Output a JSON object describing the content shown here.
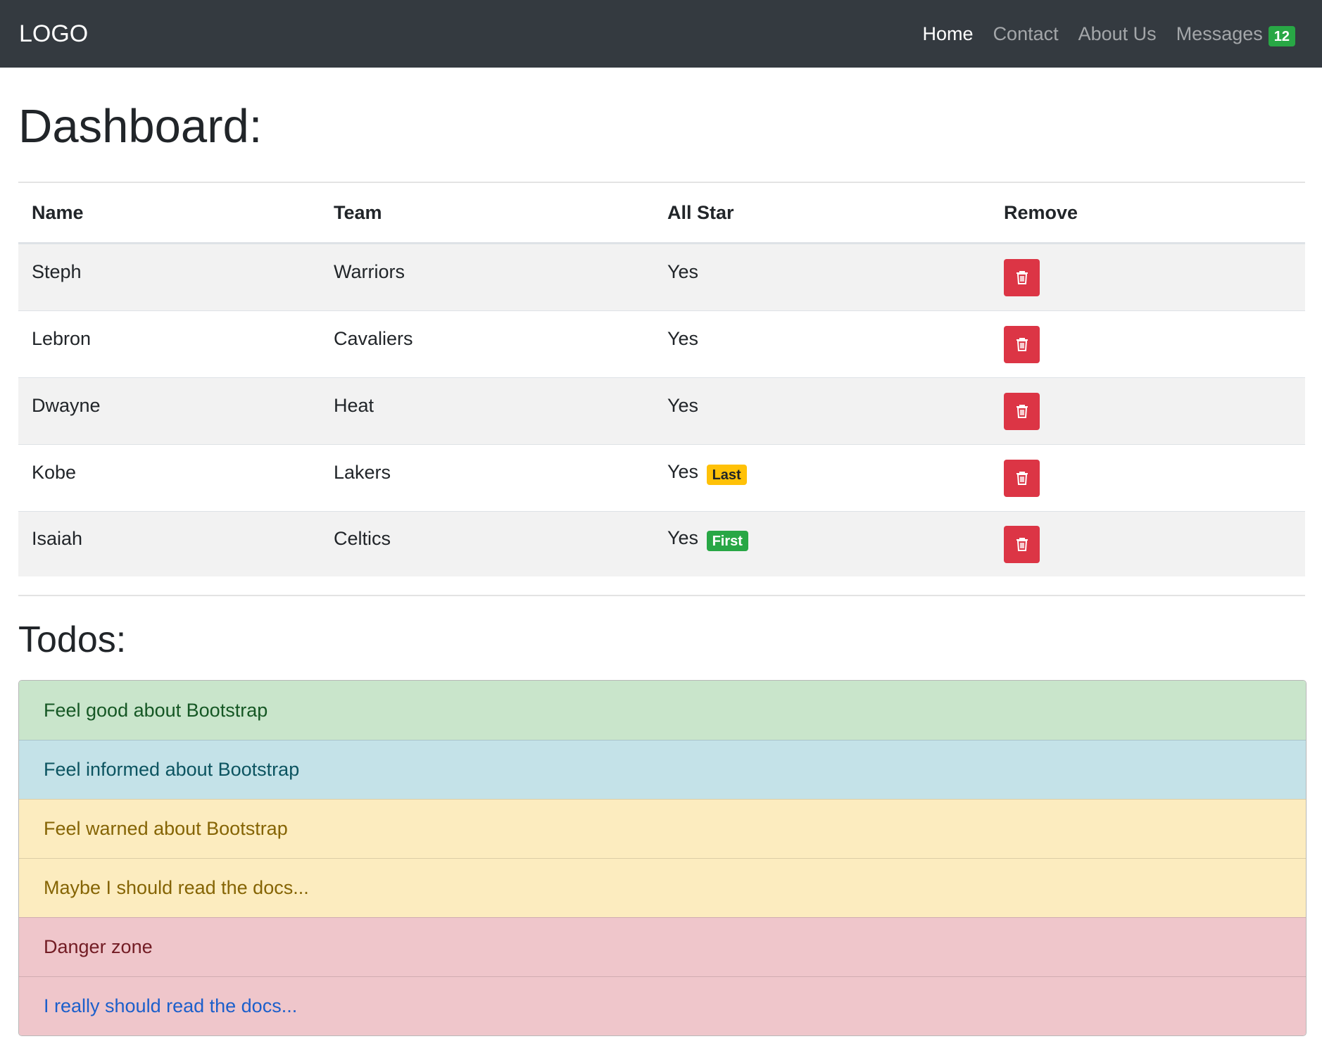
{
  "navbar": {
    "brand": "LOGO",
    "links": [
      {
        "label": "Home",
        "active": true
      },
      {
        "label": "Contact",
        "active": false
      },
      {
        "label": "About Us",
        "active": false
      },
      {
        "label": "Messages",
        "active": false,
        "badge": "12"
      }
    ]
  },
  "dashboard": {
    "title": "Dashboard:",
    "columns": [
      "Name",
      "Team",
      "All Star",
      "Remove"
    ],
    "rows": [
      {
        "name": "Steph",
        "team": "Warriors",
        "all_star": "Yes",
        "tag": ""
      },
      {
        "name": "Lebron",
        "team": "Cavaliers",
        "all_star": "Yes",
        "tag": ""
      },
      {
        "name": "Dwayne",
        "team": "Heat",
        "all_star": "Yes",
        "tag": ""
      },
      {
        "name": "Kobe",
        "team": "Lakers",
        "all_star": "Yes",
        "tag": "Last"
      },
      {
        "name": "Isaiah",
        "team": "Celtics",
        "all_star": "Yes",
        "tag": "First"
      }
    ],
    "remove_icon": "trash-icon"
  },
  "todos": {
    "title": "Todos:",
    "items": [
      {
        "text": "Feel good about Bootstrap",
        "variant": "success"
      },
      {
        "text": "Feel informed about Bootstrap",
        "variant": "info"
      },
      {
        "text": "Feel warned about Bootstrap",
        "variant": "warning"
      },
      {
        "text": "Maybe I should read the docs...",
        "variant": "warning"
      },
      {
        "text": "Danger zone",
        "variant": "danger"
      },
      {
        "text": "I really should read the docs...",
        "variant": "danger-link"
      }
    ]
  },
  "colors": {
    "navbar_bg": "#343a40",
    "danger": "#dc3545",
    "success": "#28a745",
    "warning": "#ffc107"
  }
}
